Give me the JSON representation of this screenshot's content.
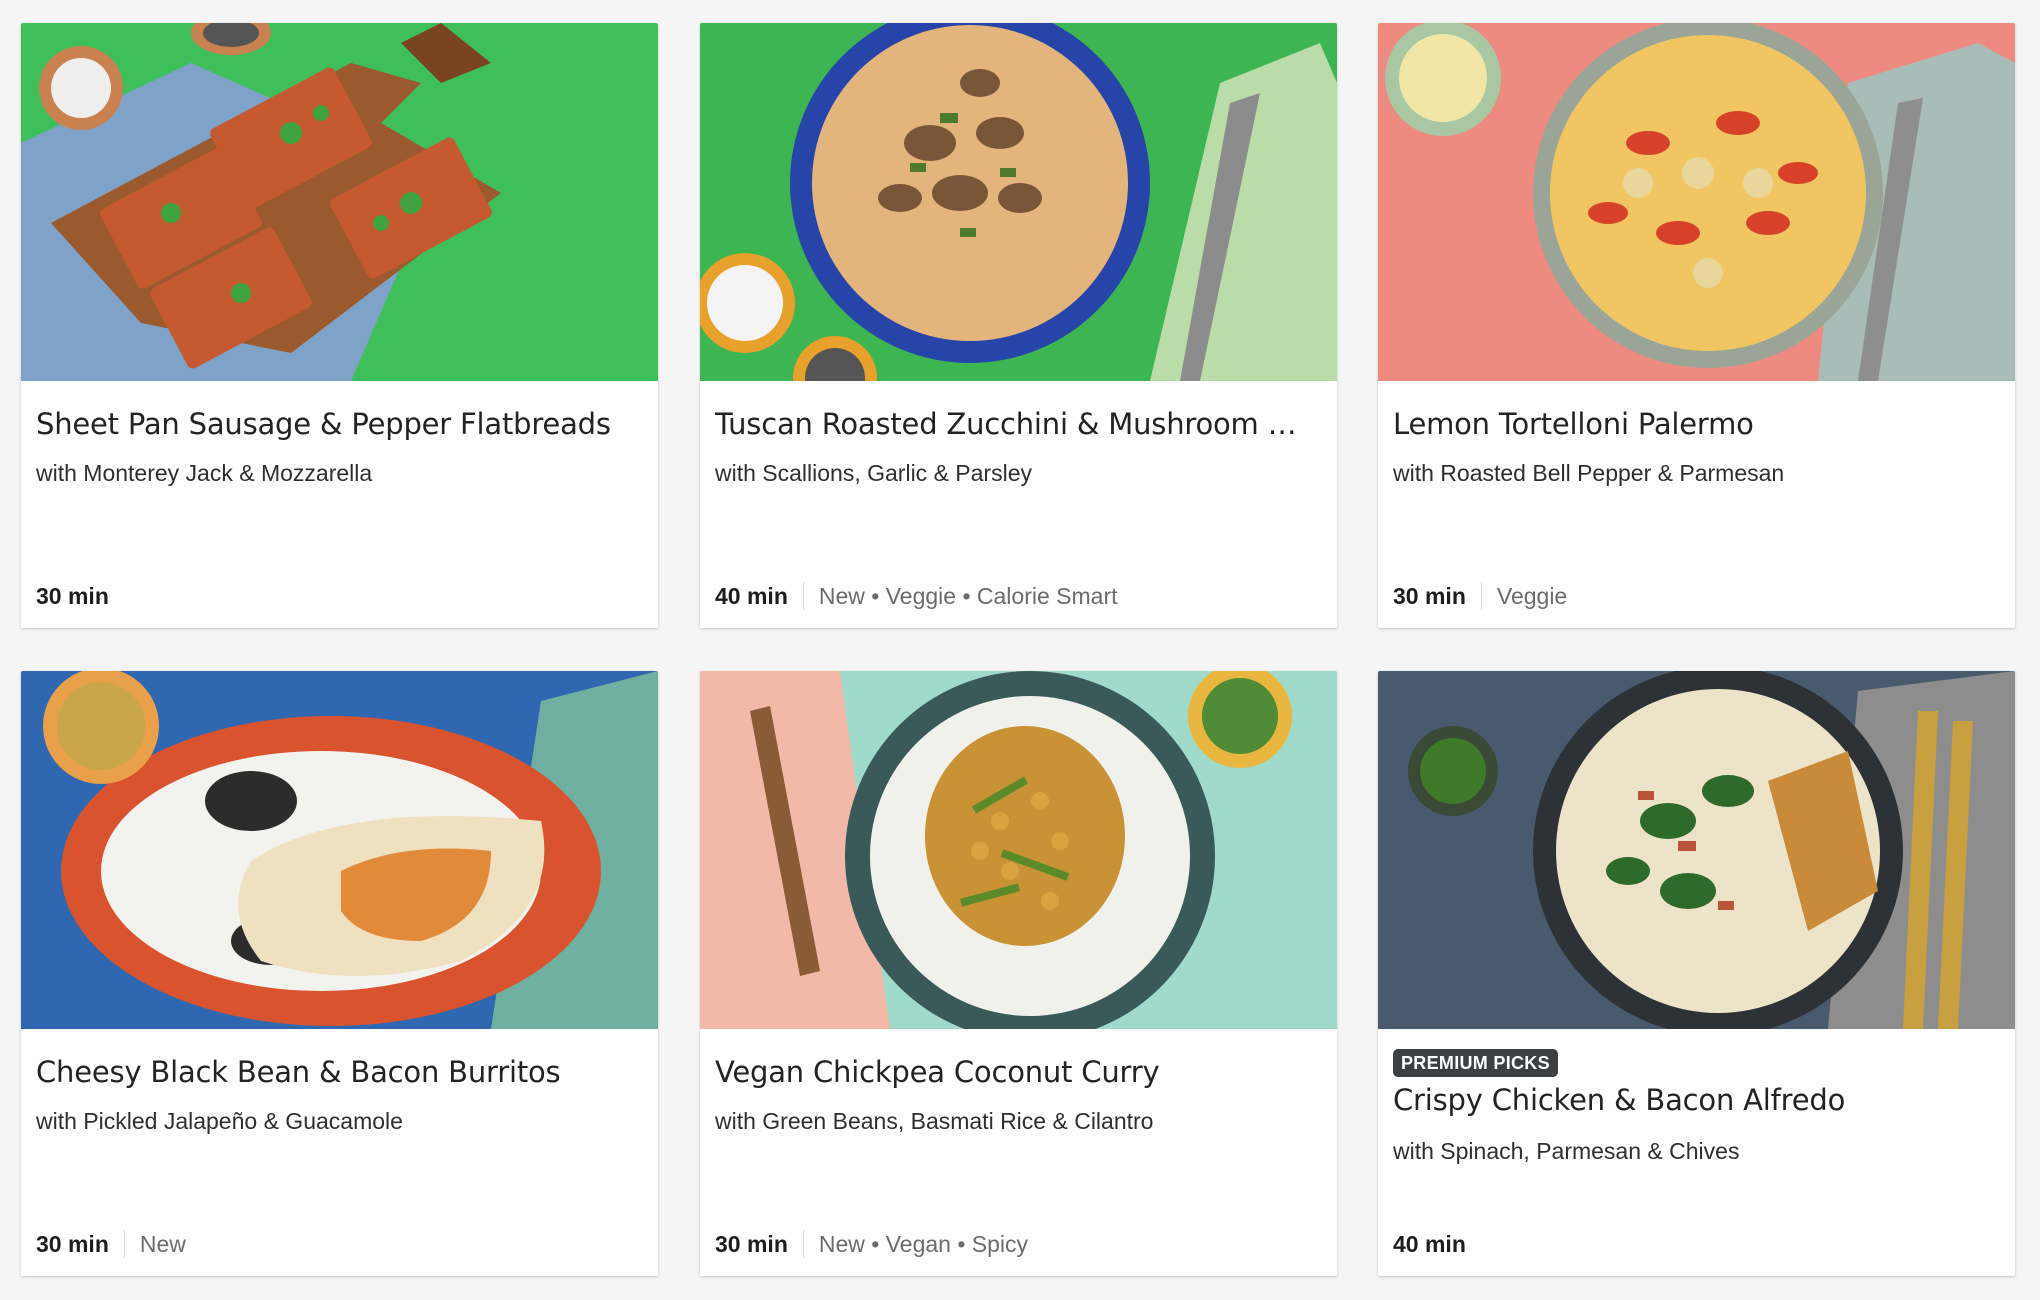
{
  "recipes": [
    {
      "title": "Sheet Pan Sausage & Pepper Flatbreads",
      "subtitle": "with Monterey Jack & Mozzarella",
      "time": "30 min",
      "tags": "",
      "badge": "",
      "image": "flatbread-photo"
    },
    {
      "title": "Tuscan Roasted Zucchini & Mushroom Risotto",
      "subtitle": "with Scallions, Garlic & Parsley",
      "time": "40 min",
      "tags": "New • Veggie • Calorie Smart",
      "badge": "",
      "image": "risotto-photo"
    },
    {
      "title": "Lemon Tortelloni Palermo",
      "subtitle": "with Roasted Bell Pepper & Parmesan",
      "time": "30 min",
      "tags": "Veggie",
      "badge": "",
      "image": "tortelloni-photo"
    },
    {
      "title": "Cheesy Black Bean & Bacon Burritos",
      "subtitle": "with Pickled Jalapeño & Guacamole",
      "time": "30 min",
      "tags": "New",
      "badge": "",
      "image": "burrito-photo"
    },
    {
      "title": "Vegan Chickpea Coconut Curry",
      "subtitle": "with Green Beans, Basmati Rice & Cilantro",
      "time": "30 min",
      "tags": "New • Vegan • Spicy",
      "badge": "",
      "image": "curry-photo"
    },
    {
      "title": "Crispy Chicken & Bacon Alfredo",
      "subtitle": "with Spinach, Parmesan & Chives",
      "time": "40 min",
      "tags": "",
      "badge": "PREMIUM PICKS",
      "image": "alfredo-photo"
    }
  ],
  "colors": {
    "background": "#f5f5f5",
    "card": "#ffffff",
    "badge": "#3c4043"
  }
}
